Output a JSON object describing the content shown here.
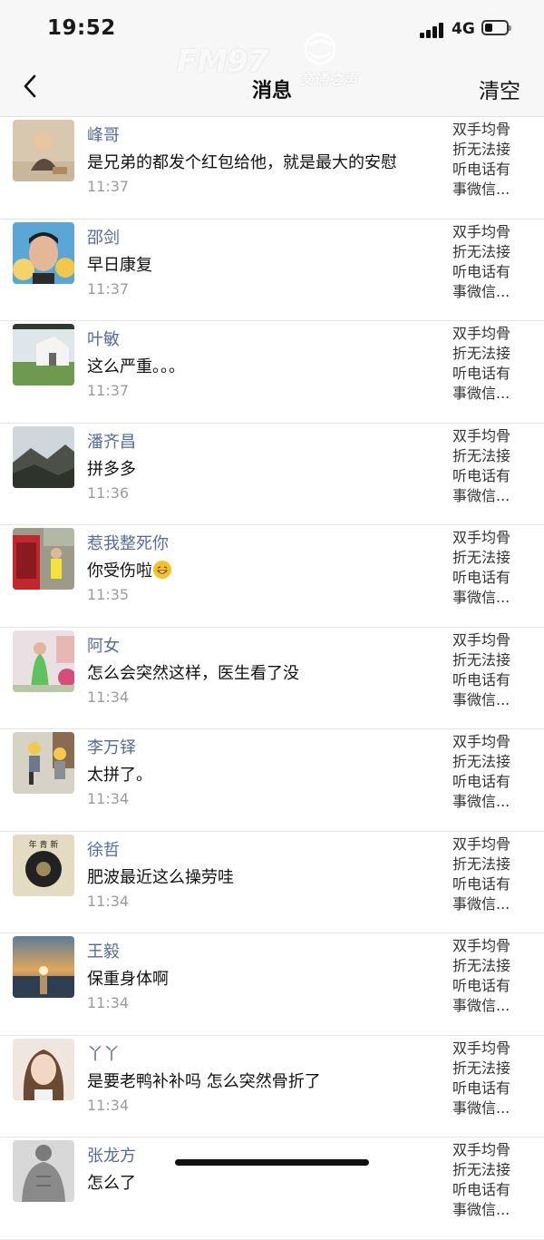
{
  "status_bar": {
    "time": "19:52",
    "network": "4G"
  },
  "nav": {
    "title": "消息",
    "clear_label": "清空"
  },
  "watermark": {
    "brand": "FM97",
    "subtitle": "交通之声"
  },
  "messages": [
    {
      "name": "峰哥",
      "text": "是兄弟的都发个红包给他，就是最大的安慰",
      "time": "11:37",
      "avatar": "avatar-child-photo",
      "preview": [
        "双手均骨",
        "折无法接",
        "听电话有",
        "事微信..."
      ]
    },
    {
      "name": "邵剑",
      "text": "早日康复",
      "time": "11:37",
      "avatar": "avatar-man-photo",
      "preview": [
        "双手均骨",
        "折无法接",
        "听电话有",
        "事微信..."
      ]
    },
    {
      "name": "叶敏",
      "text": "这么严重。。。",
      "time": "11:37",
      "avatar": "avatar-house-photo",
      "preview": [
        "双手均骨",
        "折无法接",
        "听电话有",
        "事微信..."
      ]
    },
    {
      "name": "潘齐昌",
      "text": "拼多多",
      "time": "11:36",
      "avatar": "avatar-mountain-photo",
      "preview": [
        "双手均骨",
        "折无法接",
        "听电话有",
        "事微信..."
      ]
    },
    {
      "name": "惹我整死你",
      "text": "你受伤啦",
      "time": "11:35",
      "avatar": "avatar-phonebooth-photo",
      "emoji": true,
      "preview": [
        "双手均骨",
        "折无法接",
        "听电话有",
        "事微信..."
      ]
    },
    {
      "name": "阿女",
      "text": "怎么会突然这样，医生看了没",
      "time": "11:34",
      "avatar": "avatar-woman-photo",
      "preview": [
        "双手均骨",
        "折无法接",
        "听电话有",
        "事微信..."
      ]
    },
    {
      "name": "李万铎",
      "text": "太拼了。",
      "time": "11:34",
      "avatar": "avatar-kids-photo",
      "preview": [
        "双手均骨",
        "折无法接",
        "听电话有",
        "事微信..."
      ]
    },
    {
      "name": "徐哲",
      "text": "肥波最近这么操劳哇",
      "time": "11:34",
      "avatar": "avatar-record-photo",
      "preview": [
        "双手均骨",
        "折无法接",
        "听电话有",
        "事微信..."
      ]
    },
    {
      "name": "王毅",
      "text": "保重身体啊",
      "time": "11:34",
      "avatar": "avatar-sunset-photo",
      "preview": [
        "双手均骨",
        "折无法接",
        "听电话有",
        "事微信..."
      ]
    },
    {
      "name": "丫丫",
      "text": "是要老鸭补补吗 怎么突然骨折了",
      "time": "11:34",
      "avatar": "avatar-girl-photo",
      "preview": [
        "双手均骨",
        "折无法接",
        "听电话有",
        "事微信..."
      ]
    },
    {
      "name": "张龙方",
      "text": "怎么了",
      "time": "",
      "avatar": "avatar-muscle-photo",
      "preview": [
        "双手均骨",
        "折无法接",
        "听电话有",
        "事微信..."
      ]
    }
  ]
}
